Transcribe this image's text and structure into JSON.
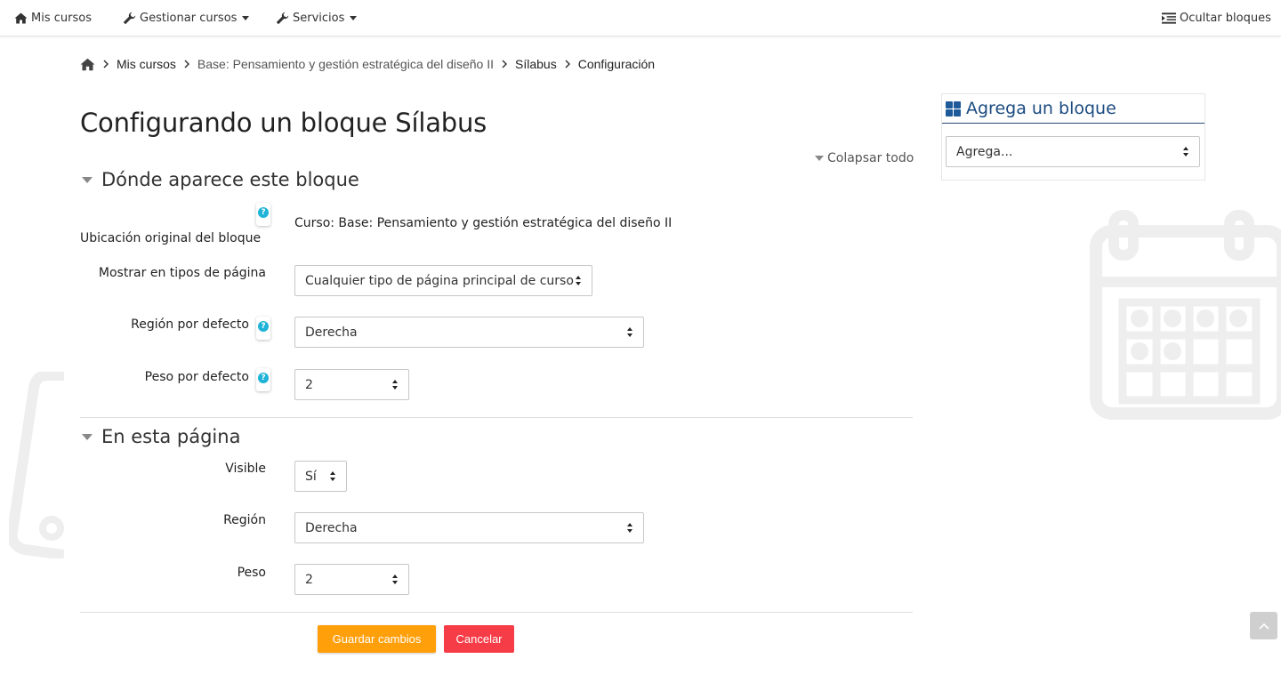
{
  "topnav": {
    "my_courses": "Mis cursos",
    "manage_courses": "Gestionar cursos",
    "services": "Servicios",
    "hide_blocks": "Ocultar bloques"
  },
  "breadcrumb": {
    "items": [
      "Mis cursos",
      "Base: Pensamiento y gestión estratégica del diseño II",
      "Sílabus",
      "Configuración"
    ]
  },
  "page": {
    "title": "Configurando un bloque Sílabus",
    "collapse_all": "Colapsar todo"
  },
  "section1": {
    "title": "Dónde aparece este bloque",
    "original_location_label": "Ubicación original del bloque",
    "original_location_value": "Curso: Base: Pensamiento y gestión estratégica del diseño II",
    "page_types_label": "Mostrar en tipos de página",
    "page_types_value": "Cualquier tipo de página principal de curso",
    "default_region_label": "Región por defecto",
    "default_region_value": "Derecha",
    "default_weight_label": "Peso por defecto",
    "default_weight_value": "2"
  },
  "section2": {
    "title": "En esta página",
    "visible_label": "Visible",
    "visible_value": "Sí",
    "region_label": "Región",
    "region_value": "Derecha",
    "weight_label": "Peso",
    "weight_value": "2"
  },
  "buttons": {
    "save": "Guardar cambios",
    "cancel": "Cancelar"
  },
  "add_block": {
    "title": "Agrega un bloque",
    "select_value": "Agrega..."
  },
  "help_glyph": "?",
  "colors": {
    "save": "#ff9f0a",
    "cancel": "#f63c46",
    "block_title": "#1b4b80",
    "help": "#1fb3d8"
  },
  "icons": [
    "home-icon",
    "wrench-icon",
    "list-icon",
    "chevron-right-icon",
    "help-icon",
    "grid-icon",
    "chevron-up-icon",
    "calendar-watermark-icon"
  ]
}
